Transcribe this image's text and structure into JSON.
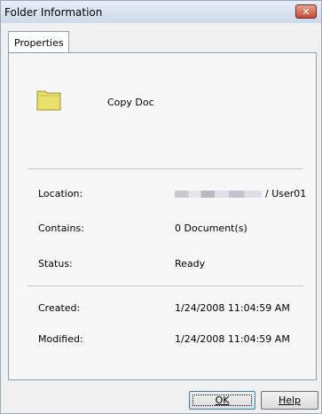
{
  "window": {
    "title": "Folder Information",
    "close_glyph": "✕"
  },
  "tabs": [
    {
      "label": "Properties"
    }
  ],
  "folder": {
    "name": "Copy Doc",
    "icon": "folder-icon"
  },
  "properties": {
    "location": {
      "label": "Location:",
      "value": "/ User01"
    },
    "contains": {
      "label": "Contains:",
      "value": "0 Document(s)"
    },
    "status": {
      "label": "Status:",
      "value": "Ready"
    },
    "created": {
      "label": "Created:",
      "value": "1/24/2008 11:04:59 AM"
    },
    "modified": {
      "label": "Modified:",
      "value": "1/24/2008 11:04:59 AM"
    }
  },
  "buttons": {
    "ok": "OK",
    "help": "Help"
  },
  "colors": {
    "folder_fill": "#e8e06a",
    "folder_outline": "#9b9030",
    "close_button": "#c44a34"
  }
}
